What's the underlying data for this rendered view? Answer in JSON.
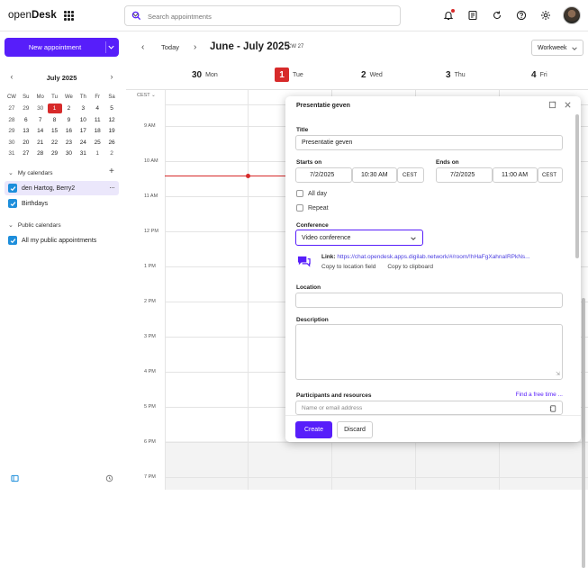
{
  "app": {
    "name_light": "open",
    "name_bold": "Desk"
  },
  "search": {
    "placeholder": "Search appointments"
  },
  "sidebar": {
    "new_label": "New appointment",
    "month_title": "July 2025",
    "week_headers": [
      "CW",
      "Su",
      "Mo",
      "Tu",
      "We",
      "Th",
      "Fr",
      "Sa"
    ],
    "weeks": [
      [
        "27",
        "29",
        "30",
        "1",
        "2",
        "3",
        "4",
        "5"
      ],
      [
        "28",
        "6",
        "7",
        "8",
        "9",
        "10",
        "11",
        "12"
      ],
      [
        "29",
        "13",
        "14",
        "15",
        "16",
        "17",
        "18",
        "19"
      ],
      [
        "30",
        "20",
        "21",
        "22",
        "23",
        "24",
        "25",
        "26"
      ],
      [
        "31",
        "27",
        "28",
        "29",
        "30",
        "31",
        "1",
        "2"
      ]
    ],
    "my_calendars_label": "My calendars",
    "my_calendar_item": "den Hartog, Berry2",
    "birthdays_item": "Birthdays",
    "public_calendars_label": "Public calendars",
    "public_item": "All my public appointments"
  },
  "header": {
    "today_label": "Today",
    "range": "June - July 2025",
    "cw": "CW 27",
    "view_select": "Workweek"
  },
  "days": [
    {
      "num": "30",
      "name": "Mon"
    },
    {
      "num": "1",
      "name": "Tue"
    },
    {
      "num": "2",
      "name": "Wed"
    },
    {
      "num": "3",
      "name": "Thu"
    },
    {
      "num": "4",
      "name": "Fri"
    }
  ],
  "timezone": "CEST",
  "hours": [
    "9 AM",
    "10 AM",
    "11 AM",
    "12 PM",
    "1 PM",
    "2 PM",
    "3 PM",
    "4 PM",
    "5 PM",
    "6 PM",
    "7 PM"
  ],
  "dialog": {
    "heading": "Presentatie geven",
    "title_label": "Title",
    "title_value": "Presentatie geven",
    "starts_label": "Starts on",
    "ends_label": "Ends on",
    "start_date": "7/2/2025",
    "start_time": "10:30 AM",
    "start_tz": "CEST",
    "end_date": "7/2/2025",
    "end_time": "11:00 AM",
    "end_tz": "CEST",
    "all_day": "All day",
    "repeat": "Repeat",
    "conference_label": "Conference",
    "conference_value": "Video conference",
    "link_label": "Link:",
    "link_url": "https://chat.opendesk.apps.digilab.network/#/room/!hHaFgXahnaIRPkNs...",
    "copy_location": "Copy to location field",
    "copy_clipboard": "Copy to clipboard",
    "location_label": "Location",
    "description_label": "Description",
    "participants_label": "Participants and resources",
    "find_free_time": "Find a free time ...",
    "participants_placeholder": "Name or email address",
    "create_label": "Create",
    "discard_label": "Discard"
  },
  "colors": {
    "accent": "#571efa",
    "today": "#d72a2a",
    "calendar_check": "#1d8edb"
  }
}
